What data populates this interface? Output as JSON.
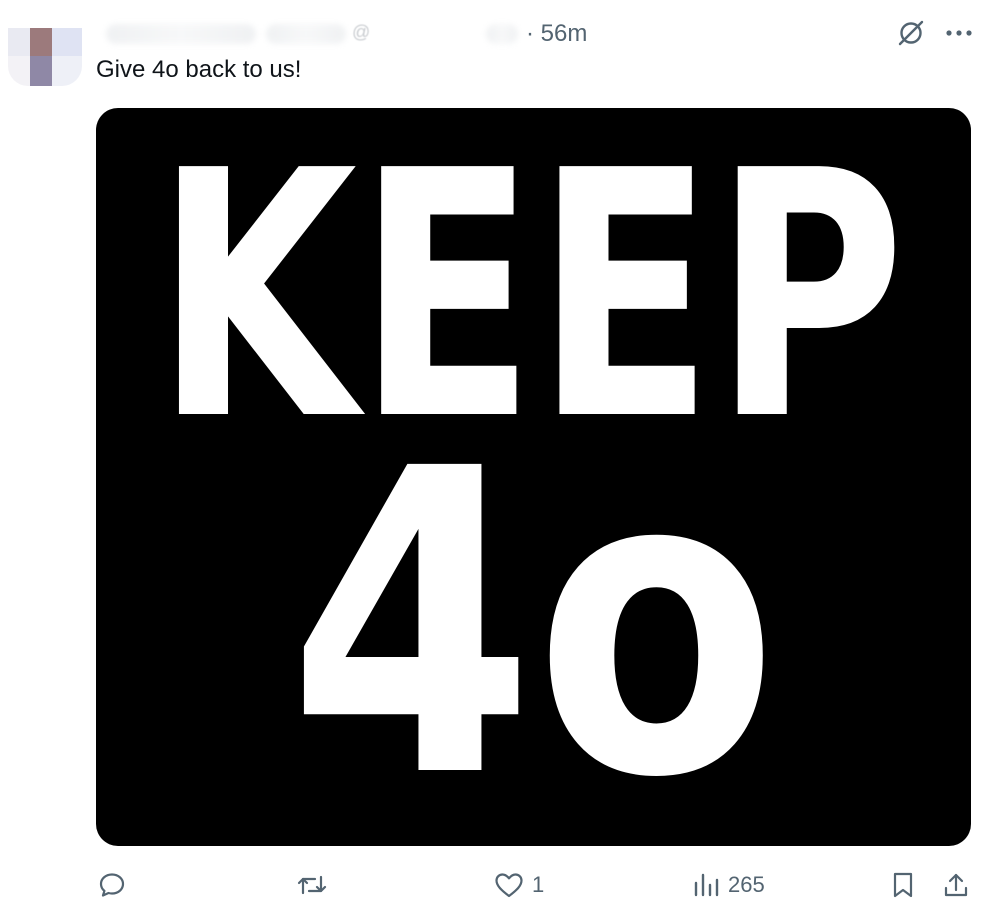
{
  "post": {
    "handle_prefix": "@",
    "separator_time": "· 56m",
    "text": "Give 4o back to us!",
    "image_text": {
      "line1": "KEEP",
      "line2": "4o"
    }
  },
  "header_icons": [
    "grok-icon",
    "more-icon"
  ],
  "actions": {
    "reply_count": "",
    "repost_count": "",
    "like_count": "1",
    "views_count": "265"
  },
  "colors": {
    "text": "#0f1419",
    "muted": "#536471",
    "image_bg": "#000000",
    "image_text": "#ffffff"
  }
}
